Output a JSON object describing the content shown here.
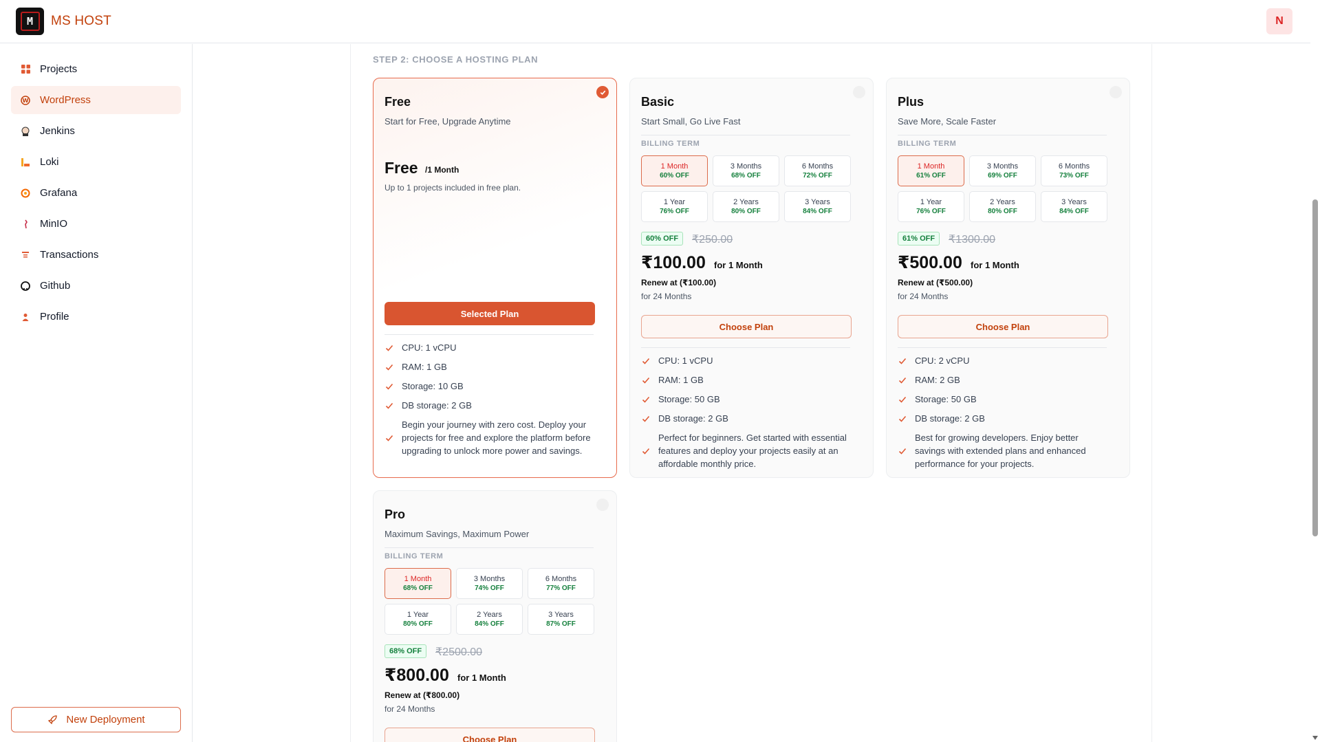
{
  "app": {
    "brand": "MS HOST",
    "logo_letter": "M",
    "avatar_letter": "N"
  },
  "sidebar": {
    "items": [
      {
        "label": "Projects",
        "icon": "grid-icon",
        "active": false
      },
      {
        "label": "WordPress",
        "icon": "wordpress-icon",
        "active": true
      },
      {
        "label": "Jenkins",
        "icon": "jenkins-icon",
        "active": false
      },
      {
        "label": "Loki",
        "icon": "loki-icon",
        "active": false
      },
      {
        "label": "Grafana",
        "icon": "grafana-icon",
        "active": false
      },
      {
        "label": "MinIO",
        "icon": "minio-icon",
        "active": false
      },
      {
        "label": "Transactions",
        "icon": "transactions-icon",
        "active": false
      },
      {
        "label": "Github",
        "icon": "github-icon",
        "active": false
      },
      {
        "label": "Profile",
        "icon": "user-icon",
        "active": false
      }
    ],
    "new_deployment": "New Deployment"
  },
  "step_title": "STEP 2: CHOOSE A HOSTING PLAN",
  "billing_term_label": "BILLING TERM",
  "plans": [
    {
      "name": "Free",
      "tagline": "Start for Free, Upgrade Anytime",
      "price": "Free",
      "period": "/1 Month",
      "note": "Up to 1 projects included in free plan.",
      "button": "Selected Plan",
      "selected": true,
      "features": [
        "CPU: 1 vCPU",
        "RAM: 1 GB",
        "Storage: 10 GB",
        "DB storage: 2 GB"
      ],
      "description": "Begin your journey with zero cost. Deploy your projects for free and explore the platform before upgrading to unlock more power and savings."
    },
    {
      "name": "Basic",
      "tagline": "Start Small, Go Live Fast",
      "terms": [
        {
          "label": "1 Month",
          "off": "60% OFF",
          "active": true
        },
        {
          "label": "3 Months",
          "off": "68% OFF"
        },
        {
          "label": "6 Months",
          "off": "72% OFF"
        },
        {
          "label": "1 Year",
          "off": "76% OFF"
        },
        {
          "label": "2 Years",
          "off": "80% OFF"
        },
        {
          "label": "3 Years",
          "off": "84% OFF"
        }
      ],
      "badge": "60% OFF",
      "original_price": "₹250.00",
      "price": "₹100.00",
      "period": "for 1 Month",
      "renew": "Renew at (₹100.00)",
      "renew_term": "for 24 Months",
      "button": "Choose Plan",
      "selected": false,
      "features": [
        "CPU: 1 vCPU",
        "RAM: 1 GB",
        "Storage: 50 GB",
        "DB storage: 2 GB"
      ],
      "description": "Perfect for beginners. Get started with essential features and deploy your projects easily at an affordable monthly price."
    },
    {
      "name": "Plus",
      "tagline": "Save More, Scale Faster",
      "terms": [
        {
          "label": "1 Month",
          "off": "61% OFF",
          "active": true
        },
        {
          "label": "3 Months",
          "off": "69% OFF"
        },
        {
          "label": "6 Months",
          "off": "73% OFF"
        },
        {
          "label": "1 Year",
          "off": "76% OFF"
        },
        {
          "label": "2 Years",
          "off": "80% OFF"
        },
        {
          "label": "3 Years",
          "off": "84% OFF"
        }
      ],
      "badge": "61% OFF",
      "original_price": "₹1300.00",
      "price": "₹500.00",
      "period": "for 1 Month",
      "renew": "Renew at (₹500.00)",
      "renew_term": "for 24 Months",
      "button": "Choose Plan",
      "selected": false,
      "features": [
        "CPU: 2 vCPU",
        "RAM: 2 GB",
        "Storage: 50 GB",
        "DB storage: 2 GB"
      ],
      "description": "Best for growing developers. Enjoy better savings with extended plans and enhanced performance for your projects."
    },
    {
      "name": "Pro",
      "tagline": "Maximum Savings, Maximum Power",
      "terms": [
        {
          "label": "1 Month",
          "off": "68% OFF",
          "active": true
        },
        {
          "label": "3 Months",
          "off": "74% OFF"
        },
        {
          "label": "6 Months",
          "off": "77% OFF"
        },
        {
          "label": "1 Year",
          "off": "80% OFF"
        },
        {
          "label": "2 Years",
          "off": "84% OFF"
        },
        {
          "label": "3 Years",
          "off": "87% OFF"
        }
      ],
      "badge": "68% OFF",
      "original_price": "₹2500.00",
      "price": "₹800.00",
      "period": "for 1 Month",
      "renew": "Renew at (₹800.00)",
      "renew_term": "for 24 Months",
      "button": "Choose Plan",
      "selected": false
    }
  ],
  "colors": {
    "accent": "#d95530",
    "accent_text": "#c2410c",
    "success": "#15803d"
  }
}
